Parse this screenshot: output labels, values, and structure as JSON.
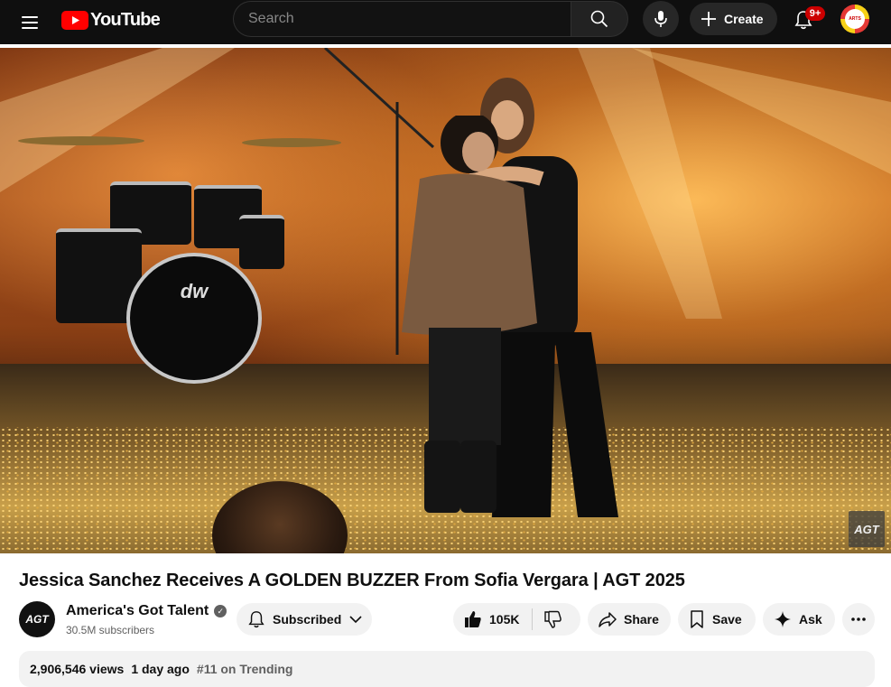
{
  "header": {
    "logo_text": "YouTube",
    "search_placeholder": "Search",
    "create_label": "Create",
    "notification_count": "9+",
    "avatar_text": "ARTS"
  },
  "video": {
    "watermark": "AGT",
    "drum_brand": "dw"
  },
  "details": {
    "title": "Jessica Sanchez Receives A GOLDEN BUZZER From Sofia Vergara | AGT 2025",
    "channel_name": "America's Got Talent",
    "channel_avatar_text": "AGT",
    "subscribers": "30.5M subscribers",
    "subscribe_label": "Subscribed",
    "like_count": "105K",
    "share_label": "Share",
    "save_label": "Save",
    "ask_label": "Ask",
    "views": "2,906,546 views",
    "age": "1 day ago",
    "trending": "#11 on Trending"
  },
  "colors": {
    "topbar_bg": "#0f0f0f",
    "brand_red": "#ff0000",
    "pill_bg": "#f2f2f2"
  },
  "icons": [
    "menu-icon",
    "youtube-logo-icon",
    "search-icon",
    "mic-icon",
    "plus-icon",
    "bell-icon",
    "bell-icon",
    "verified-icon",
    "chevron-down-icon",
    "thumbs-up-icon",
    "thumbs-down-icon",
    "share-icon",
    "bookmark-icon",
    "sparkle-icon",
    "more-icon"
  ]
}
